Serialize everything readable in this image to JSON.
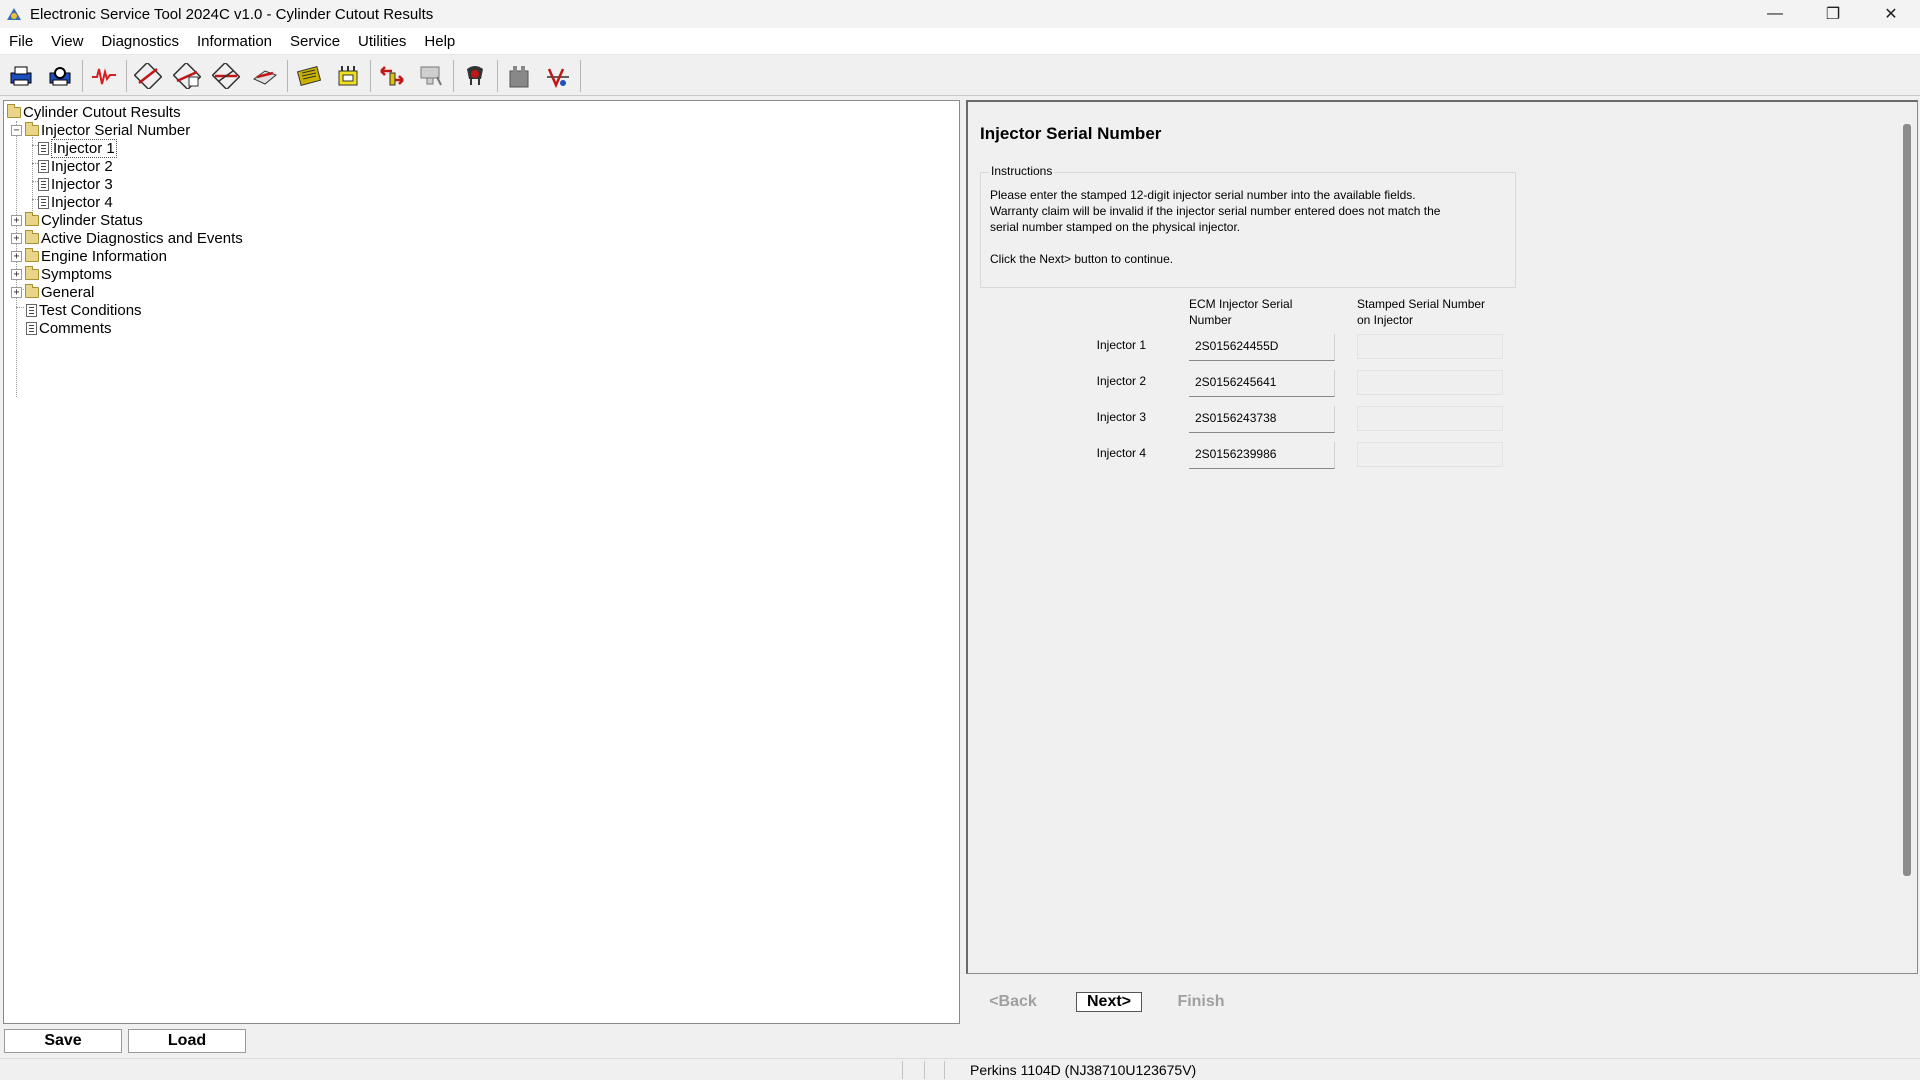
{
  "window": {
    "title": "Electronic Service Tool 2024C v1.0 - Cylinder Cutout Results",
    "controls": [
      "minimize",
      "restore",
      "close"
    ]
  },
  "menu": [
    "File",
    "View",
    "Diagnostics",
    "Information",
    "Service",
    "Utilities",
    "Help"
  ],
  "toolbar": {
    "icons": [
      "print-icon",
      "print-preview-icon",
      "status-graph-icon",
      "active-diagnostics-icon",
      "logged-diagnostics-icon",
      "events-icon",
      "clear-codes-icon",
      "ecm-summary-icon",
      "configuration-icon",
      "transfer-icon",
      "flash-icon",
      "cylinder-cutout-icon",
      "calibrations-icon",
      "wiring-icon"
    ]
  },
  "tree": {
    "root": "Cylinder Cutout Results",
    "items": [
      {
        "label": "Injector Serial Number",
        "type": "folder",
        "expanded": true
      },
      {
        "label": "Injector 1",
        "type": "doc",
        "selected": true
      },
      {
        "label": "Injector 2",
        "type": "doc"
      },
      {
        "label": "Injector 3",
        "type": "doc"
      },
      {
        "label": "Injector 4",
        "type": "doc"
      },
      {
        "label": "Cylinder Status",
        "type": "folder"
      },
      {
        "label": "Active Diagnostics and Events",
        "type": "folder"
      },
      {
        "label": "Engine Information",
        "type": "folder"
      },
      {
        "label": "Symptoms",
        "type": "folder"
      },
      {
        "label": "General",
        "type": "folder"
      },
      {
        "label": "Test Conditions",
        "type": "doc"
      },
      {
        "label": "Comments",
        "type": "doc"
      }
    ]
  },
  "panel": {
    "heading": "Injector Serial Number",
    "instructions_label": "Instructions",
    "instructions_text": "Please enter the stamped 12-digit injector serial number into the available fields.\nWarranty claim will be invalid if the injector serial number entered does not match the\nserial number stamped on the physical injector.\n\nClick the Next> button to continue.",
    "col_ecm": "ECM Injector Serial\nNumber",
    "col_stamped": "Stamped Serial Number\non Injector",
    "rows": [
      {
        "label": "Injector 1",
        "ecm": "2S015624455D",
        "stamped": ""
      },
      {
        "label": "Injector 2",
        "ecm": "2S0156245641",
        "stamped": ""
      },
      {
        "label": "Injector 3",
        "ecm": "2S0156243738",
        "stamped": ""
      },
      {
        "label": "Injector 4",
        "ecm": "2S0156239986",
        "stamped": ""
      }
    ]
  },
  "wizard": {
    "back": "<Back",
    "next": "Next>",
    "finish": "Finish"
  },
  "bottom": {
    "save": "Save",
    "load": "Load"
  },
  "status": {
    "ecm": "Perkins 1104D (NJ38710U123675V)"
  }
}
